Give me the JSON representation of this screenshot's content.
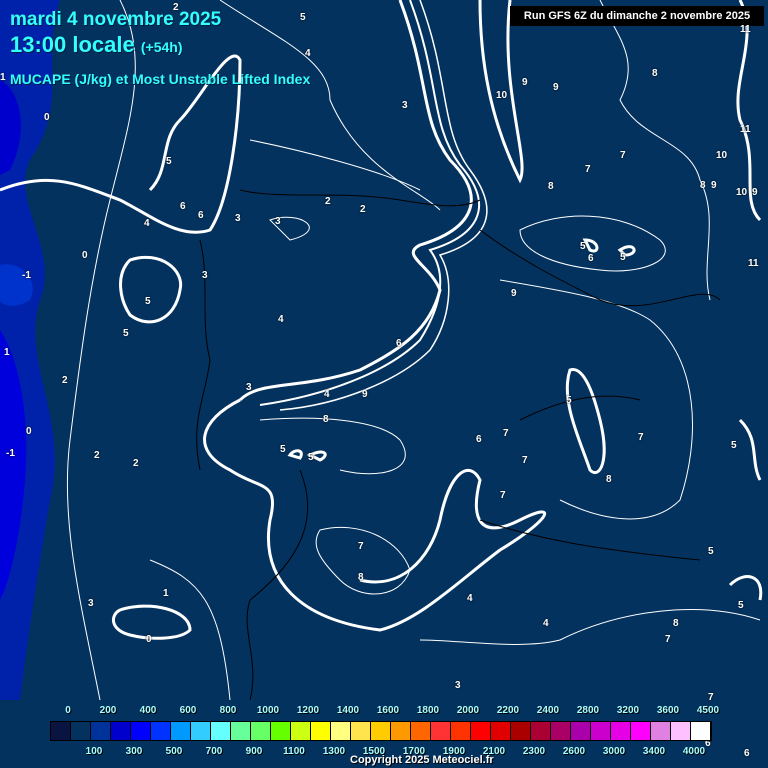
{
  "header": {
    "date": "mardi 4 novembre 2025",
    "time": "13:00 locale",
    "lead": "(+54h)",
    "subtitle": "MUCAPE (J/kg) et Most Unstable Lifted Index",
    "run": "Run GFS 6Z du dimanche 2 novembre 2025"
  },
  "contour_labels": [
    "2",
    "5",
    "4",
    "3",
    "1",
    "0",
    "5",
    "6",
    "6",
    "4",
    "3",
    "2",
    "2",
    "3",
    "0",
    "-1",
    "3",
    "5",
    "5",
    "4",
    "1",
    "2",
    "-1",
    "0",
    "2",
    "2",
    "3",
    "4",
    "9",
    "8",
    "5",
    "5",
    "1",
    "0",
    "3",
    "7",
    "8",
    "4",
    "4",
    "3",
    "10",
    "9",
    "9",
    "8",
    "7",
    "7",
    "8",
    "8",
    "9",
    "10",
    "9",
    "11",
    "11",
    "10",
    "5",
    "6",
    "5",
    "9",
    "6",
    "11",
    "5",
    "7",
    "6",
    "7",
    "7",
    "8",
    "5",
    "7",
    "5",
    "8",
    "5",
    "7",
    "7",
    "6",
    "6"
  ],
  "legend": {
    "colors": [
      "#0a1440",
      "#04325f",
      "#003399",
      "#0000cc",
      "#0000ff",
      "#0033ff",
      "#0099ff",
      "#33ccff",
      "#66ffff",
      "#66ff99",
      "#66ff66",
      "#66ff00",
      "#ccff11",
      "#ffff00",
      "#ffff80",
      "#ffe44d",
      "#ffcc00",
      "#ff9900",
      "#ff6600",
      "#ff3333",
      "#ff3300",
      "#ff0000",
      "#e00000",
      "#aa0000",
      "#aa0033",
      "#aa0066",
      "#aa00aa",
      "#cc00cc",
      "#e600e6",
      "#ff00ff",
      "#e080e0",
      "#ffc0ff",
      "#ffffff"
    ],
    "top_labels": [
      "0",
      "200",
      "400",
      "600",
      "800",
      "1000",
      "1200",
      "1400",
      "1600",
      "1800",
      "2000",
      "2200",
      "2400",
      "2800",
      "3200",
      "3600",
      "4500"
    ],
    "bottom_labels": [
      "100",
      "300",
      "500",
      "700",
      "900",
      "1100",
      "1300",
      "1500",
      "1700",
      "1900",
      "2100",
      "2300",
      "2600",
      "3000",
      "3400",
      "4000"
    ]
  },
  "copyright": "Copyright 2025 Meteociel.fr"
}
